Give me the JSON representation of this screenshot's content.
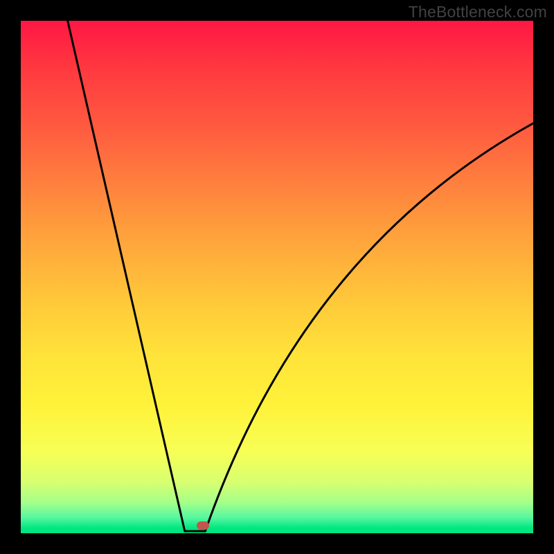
{
  "watermark": "TheBottleneck.com",
  "chart_data": {
    "type": "line",
    "title": "",
    "xlabel": "",
    "ylabel": "",
    "xlim": [
      0,
      100
    ],
    "ylim": [
      0,
      100
    ],
    "curve": {
      "tip_x": 34,
      "tip_y": 0,
      "left_start_x": 8,
      "left_start_y": 105,
      "left_ctrl_x": 30,
      "left_ctrl_y": 10,
      "right_ctrl_x": 55,
      "right_ctrl_y": 55,
      "right_end_x": 100,
      "right_end_y": 80,
      "flat_half_width": 2
    },
    "marker": {
      "x": 35.5,
      "y": 1.5
    },
    "gradient_stops": [
      {
        "pos": 0,
        "color": "#ff1744"
      },
      {
        "pos": 50,
        "color": "#ffe23a"
      },
      {
        "pos": 100,
        "color": "#00e680"
      }
    ]
  }
}
